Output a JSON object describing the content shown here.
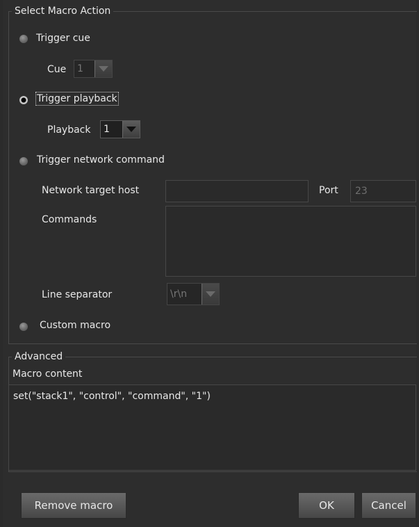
{
  "dialog": {
    "select_group": {
      "legend": "Select Macro Action",
      "trigger_cue": {
        "label": "Trigger cue",
        "cue_label": "Cue",
        "cue_value": "1"
      },
      "trigger_playback": {
        "label": "Trigger playback",
        "playback_label": "Playback",
        "playback_value": "1"
      },
      "trigger_network": {
        "label": "Trigger network command",
        "host_label": "Network target host",
        "host_value": "",
        "port_label": "Port",
        "port_value": "23",
        "commands_label": "Commands",
        "separator_label": "Line separator",
        "separator_value": "\\r\\n"
      },
      "custom_macro": {
        "label": "Custom macro"
      }
    },
    "advanced_group": {
      "legend": "Advanced",
      "content_label": "Macro content",
      "content_value": "set(\"stack1\", \"control\", \"command\", \"1\")"
    },
    "buttons": {
      "remove": "Remove macro",
      "ok": "OK",
      "cancel": "Cancel"
    }
  },
  "selected_action": "Trigger playback"
}
